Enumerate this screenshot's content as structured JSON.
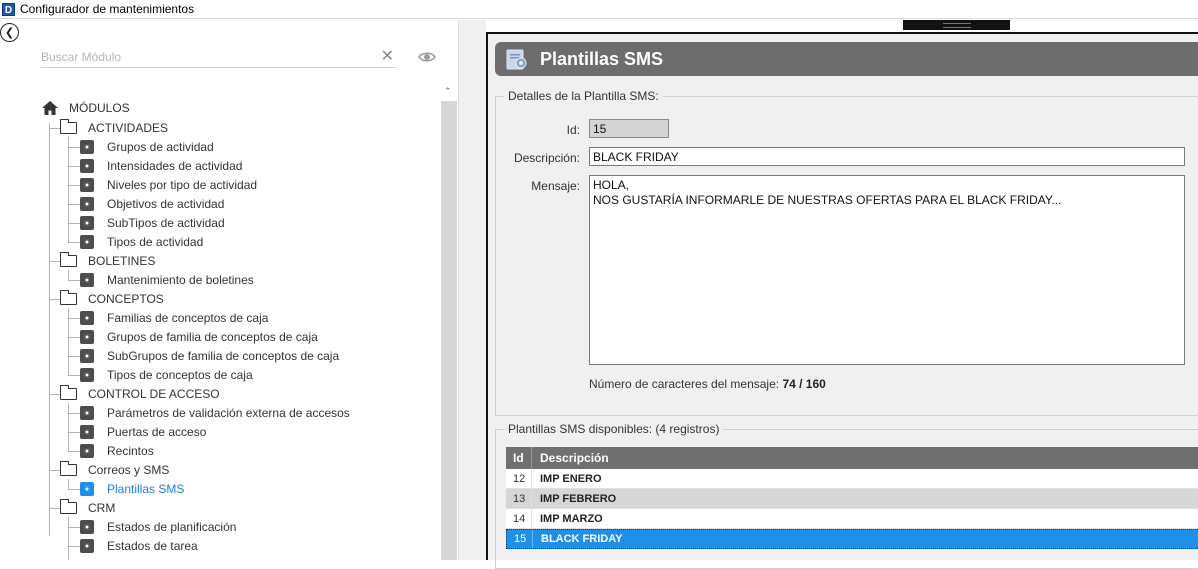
{
  "window": {
    "title": "Configurador de mantenimientos",
    "app_icon_letter": "D"
  },
  "sidebar": {
    "search_placeholder": "Buscar Módulo",
    "clear_glyph": "✕",
    "root_label": "MÓDULOS",
    "items": [
      {
        "label": "ACTIVIDADES"
      },
      {
        "label": "Grupos de actividad"
      },
      {
        "label": "Intensidades de actividad"
      },
      {
        "label": "Niveles por tipo de actividad"
      },
      {
        "label": "Objetivos de actividad"
      },
      {
        "label": "SubTipos de actividad"
      },
      {
        "label": "Tipos de actividad"
      },
      {
        "label": "BOLETINES"
      },
      {
        "label": "Mantenimiento de boletines"
      },
      {
        "label": "CONCEPTOS"
      },
      {
        "label": "Familias de conceptos de caja"
      },
      {
        "label": "Grupos de familia de conceptos de caja"
      },
      {
        "label": "SubGrupos de familia de conceptos de caja"
      },
      {
        "label": "Tipos de conceptos de caja"
      },
      {
        "label": "CONTROL DE ACCESO"
      },
      {
        "label": "Parámetros de validación externa de accesos"
      },
      {
        "label": "Puertas de acceso"
      },
      {
        "label": "Recintos"
      },
      {
        "label": "Correos y SMS"
      },
      {
        "label": "Plantillas SMS"
      },
      {
        "label": "CRM"
      },
      {
        "label": "Estados de planificación"
      },
      {
        "label": "Estados de tarea"
      }
    ]
  },
  "main": {
    "header_title": "Plantillas SMS",
    "details": {
      "legend": "Detalles de la Plantilla SMS:",
      "id_label": "Id:",
      "id_value": "15",
      "description_label": "Descripción:",
      "description_value": "BLACK FRIDAY",
      "message_label": "Mensaje:",
      "message_value": "HOLA,\nNOS GUSTARÍA INFORMARLE DE NUESTRAS OFERTAS PARA EL BLACK FRIDAY...",
      "char_count_label": "Número de caracteres del mensaje:",
      "char_count_value": "74 / 160"
    },
    "available": {
      "legend": "Plantillas SMS disponibles:",
      "count": "(4 registros)",
      "columns": [
        "Id",
        "Descripción"
      ],
      "rows": [
        {
          "id": "12",
          "desc": "IMP ENERO"
        },
        {
          "id": "13",
          "desc": "IMP FEBRERO"
        },
        {
          "id": "14",
          "desc": "IMP MARZO"
        },
        {
          "id": "15",
          "desc": "BLACK FRIDAY"
        }
      ]
    }
  },
  "colors": {
    "accent": "#1e90e8",
    "header_bg": "#6d6d6d",
    "grid_header_bg": "#707070"
  }
}
